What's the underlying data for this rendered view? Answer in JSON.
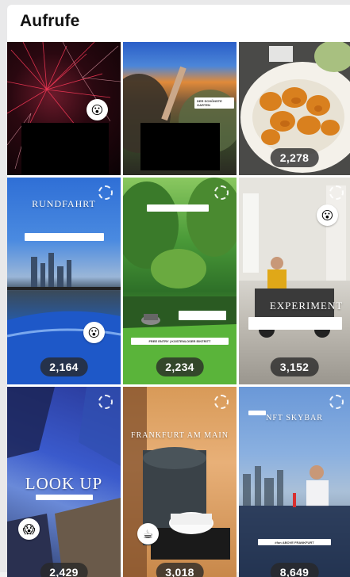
{
  "header": {
    "title": "Aufrufe"
  },
  "tiles": [
    {
      "id": "fireworks",
      "count": "",
      "badge_icon": "😮"
    },
    {
      "id": "garden-selfie",
      "count": "",
      "overlay_text": "DER SCHÖNSTE GARTEN"
    },
    {
      "id": "food-plate",
      "count": "2,278"
    },
    {
      "id": "rundfahrt",
      "count": "2,164",
      "overlay_title": "RUNDFAHRT",
      "badge_icon": "😮"
    },
    {
      "id": "green-park",
      "count": "2,234",
      "banner_text": "FREE ENTRY | KOSTENLOSER EINTRITT"
    },
    {
      "id": "experiment",
      "count": "3,152",
      "overlay_title": "EXPERIMENT",
      "badge_icon": "😮"
    },
    {
      "id": "look-up",
      "count": "2,429",
      "overlay_title": "LOOK UP",
      "badge_icon": "😱"
    },
    {
      "id": "coffee",
      "count": "3,018",
      "overlay_title": "FRANKFURT AM MAIN",
      "badge_icon": "☕"
    },
    {
      "id": "skybar",
      "count": "8,649",
      "overlay_title": "NFT SKYBAR",
      "banner_text": "#fun ABOVE FRANKFURT"
    }
  ]
}
